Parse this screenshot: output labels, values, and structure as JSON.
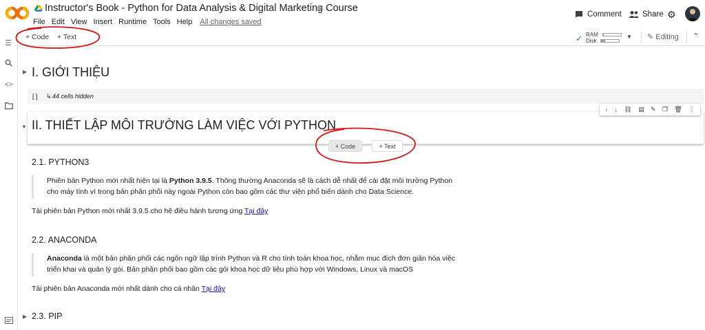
{
  "header": {
    "title": "Instructor's Book - Python for Data Analysis & Digital Marketing Course",
    "menu": [
      "File",
      "Edit",
      "View",
      "Insert",
      "Runtime",
      "Tools",
      "Help"
    ],
    "saved_status": "All changes saved",
    "comment_label": "Comment",
    "share_label": "Share"
  },
  "toolbar": {
    "add_code": "+ Code",
    "add_text": "+ Text",
    "ram_label": "RAM",
    "disk_label": "Disk",
    "ram_usage": 0.05,
    "disk_usage": 0.25,
    "mode_label": "Editing"
  },
  "notebook": {
    "section1": {
      "title": "I. GIỚI THIỆU",
      "hidden_brackets": "[ ]",
      "hidden_text": "44 cells hidden"
    },
    "section2": {
      "title": "II. THIẾT LẬP MÔI TRƯỜNG LÀM VIỆC VỚI PYTHON",
      "insert_code": "+ Code",
      "insert_text": "+ Text"
    },
    "python3": {
      "heading": "2.1. PYTHON3",
      "quote_pre": "Phiên bản Python mới nhất hiện tại là ",
      "quote_bold": "Python 3.9.5",
      "quote_post": ". Thông thường Anaconda sẽ là cách dễ nhất để cài đặt môi trường Python cho máy tính vì trong bản phân phối này ngoài Python còn bao gồm các thư viện phổ biến dành cho Data Science.",
      "download_pre": "Tải phiên bản Python mới nhất 3.9.5 cho hệ điều hành tương ứng ",
      "download_link": "Tại đây"
    },
    "anaconda": {
      "heading": "2.2. ANACONDA",
      "quote_bold": "Anaconda",
      "quote_post": " là một bản phân phối các ngôn ngữ lập trình Python và R cho tính toán khoa học, nhằm mục đích đơn giản hóa việc triển khai và quản lý gói. Bản phân phối bao gồm các gói khoa học dữ liệu phù hợp với Windows, Linux và macOS",
      "download_pre": "Tải phiên bản Anaconda mới nhất dành cho cá nhân ",
      "download_link": "Tại đây"
    },
    "pip": {
      "heading": "2.3. PIP"
    }
  },
  "colors": {
    "logo_orange": "#f9ab00",
    "logo_dark_orange": "#e8710a",
    "annotation_red": "#d31818",
    "link": "#1a0dab"
  }
}
